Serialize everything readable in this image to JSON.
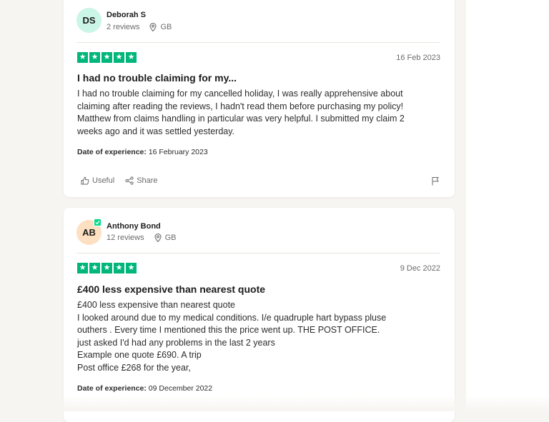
{
  "colors": {
    "star_green": "#00b67a",
    "avatar1_bg": "#cbf5e6",
    "avatar2_bg": "#fde0c2",
    "verified_green": "#04da8d"
  },
  "reviews": [
    {
      "initials": "DS",
      "name": "Deborah S",
      "review_count": "2 reviews",
      "country": "GB",
      "rating": 5,
      "date": "16 Feb 2023",
      "title": "I had no trouble claiming for my...",
      "body": [
        "I had no trouble claiming for my cancelled holiday, I was really apprehensive about",
        "claiming after reading the reviews, I hadn't read them before purchasing my policy!",
        "Matthew from claims handling in particular was very helpful. I submitted my claim 2",
        "weeks ago and it was settled yesterday."
      ],
      "experience_label": "Date of experience:",
      "experience_date": "16 February 2023",
      "useful_label": "Useful",
      "share_label": "Share"
    },
    {
      "initials": "AB",
      "name": "Anthony Bond",
      "review_count": "12 reviews",
      "country": "GB",
      "rating": 5,
      "date": "9 Dec 2022",
      "title": "£400 less expensive than nearest quote",
      "body": [
        "£400 less expensive than nearest quote",
        "I looked around due to my medical conditions. I/e quadruple hart bypass pluse",
        "outhers . Every time I mentioned this the price went up. THE POST OFFICE.",
        "just asked I'd had any problems in the last 2 years",
        "Example one quote £690. A trip",
        "Post office £268 for the year,"
      ],
      "experience_label": "Date of experience:",
      "experience_date": "09 December 2022"
    }
  ]
}
